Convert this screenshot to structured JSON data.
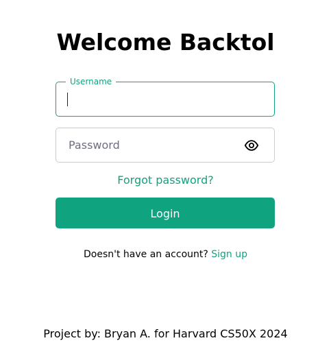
{
  "header": {
    "title": "Welcome Backtol"
  },
  "form": {
    "username": {
      "label": "Username",
      "value": "",
      "placeholder": ""
    },
    "password": {
      "value": "",
      "placeholder": "Password",
      "toggle_icon": "eye-icon"
    },
    "forgot_password": "Forgot password?",
    "login_label": "Login",
    "signup_prompt": "Doesn't have an account?",
    "signup_link": "Sign up"
  },
  "footer": {
    "text": "Project by: Bryan A. for Harvard CS50X 2024"
  },
  "colors": {
    "accent": "#10a37f",
    "border": "#c9cdd1",
    "text": "#000000",
    "background": "#ffffff"
  }
}
